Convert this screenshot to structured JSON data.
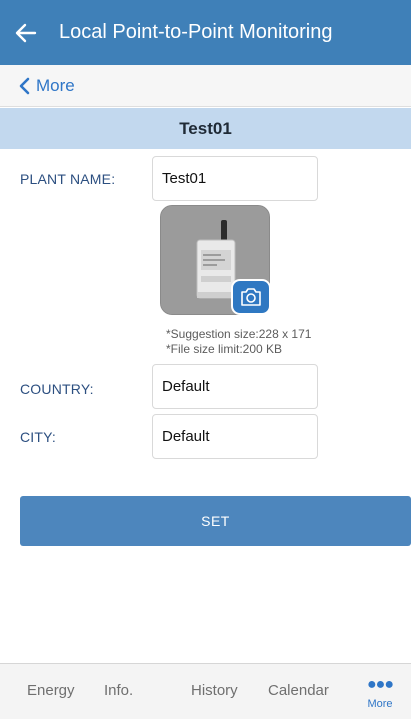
{
  "header": {
    "title": "Local Point-to-Point Monitoring",
    "back_icon": "arrow-left-icon"
  },
  "nav": {
    "back_label": "More"
  },
  "section": {
    "title": "Test01"
  },
  "form": {
    "plant_name_label": "PLANT NAME:",
    "plant_name_value": "Test01",
    "country_label": "COUNTRY:",
    "country_value": "Default",
    "city_label": "CITY:",
    "city_value": "Default"
  },
  "photo": {
    "hint_size": "*Suggestion size:228 x 171",
    "hint_limit": "*File size limit:200 KB",
    "camera_icon": "camera-icon"
  },
  "actions": {
    "set_label": "SET"
  },
  "tabbar": {
    "tabs": [
      "Energy",
      "Info.",
      "History",
      "Calendar"
    ],
    "more_label": "More"
  },
  "colors": {
    "primary": "#3f80b8",
    "section_bg": "#c2d8ee",
    "button": "#4d86bd",
    "link": "#2f76c7"
  }
}
